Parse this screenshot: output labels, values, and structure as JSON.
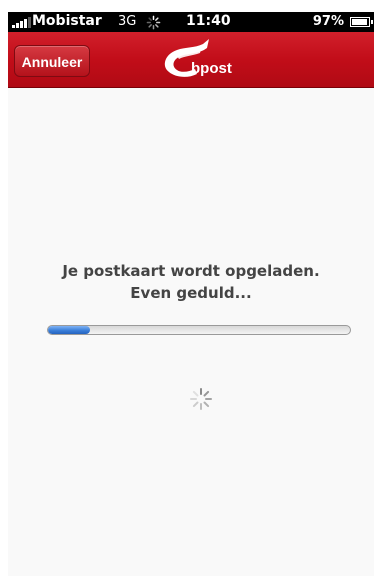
{
  "status_bar": {
    "carrier": "Mobistar",
    "network": "3G",
    "time": "11:40",
    "battery_percent": "97%",
    "battery_level": 0.97
  },
  "nav_bar": {
    "cancel_label": "Annuleer",
    "brand": "bpost",
    "logo_icon": "bpost-horn-icon",
    "color": "#c8101b"
  },
  "upload": {
    "message_line1": "Je postkaart wordt opgeladen.",
    "message_line2": "Even geduld...",
    "progress": 0.14,
    "progress_color": "#3b7fd9",
    "spinner_icon": "activity-spinner-icon"
  }
}
